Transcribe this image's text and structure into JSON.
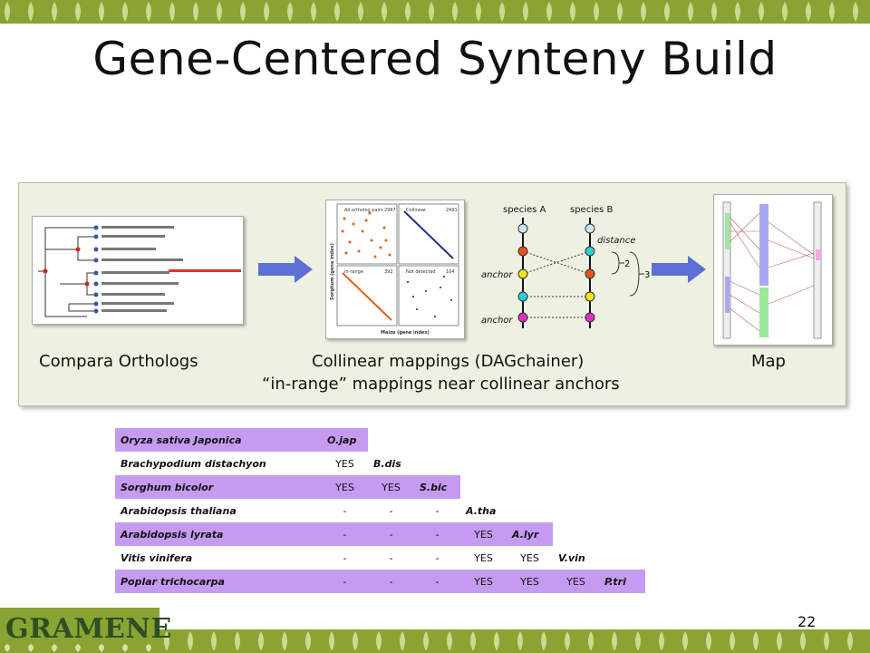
{
  "slide": {
    "title": "Gene-Centered Synteny Build",
    "page_number": "22"
  },
  "panel": {
    "caption_left": "Compara Orthologs",
    "caption_mid_1": "Collinear mappings (DAGchainer)",
    "caption_mid_2": "“in-range” mappings near collinear anchors",
    "caption_right": "Map",
    "dotplot": {
      "q1_label": "All ortholog pairs",
      "q1_count": "2987",
      "q2_label": "Collinear",
      "q2_count": "2491",
      "q3_label": "in-range",
      "q3_count": "392",
      "q4_label": "Not detected",
      "q4_count": "104",
      "ylabel": "Sorghum (gene index)",
      "xlabel": "Maize (gene index)"
    },
    "schema": {
      "species_a": "species A",
      "species_b": "species B",
      "distance": "distance",
      "anchor_1": "anchor",
      "anchor_2": "anchor",
      "num_2": "2",
      "num_3": "3"
    }
  },
  "ortholog_table": {
    "highlight_color": "#c59bf2",
    "rows": [
      {
        "species": "Oryza sativa Japonica",
        "cells": [],
        "abbr": "O.jap"
      },
      {
        "species": "Brachypodium distachyon",
        "cells": [
          "YES"
        ],
        "abbr": "B.dis"
      },
      {
        "species": "Sorghum bicolor",
        "cells": [
          "YES",
          "YES"
        ],
        "abbr": "S.bic"
      },
      {
        "species": "Arabidopsis thaliana",
        "cells": [
          "-",
          "-",
          "-"
        ],
        "abbr": "A.tha"
      },
      {
        "species": "Arabidopsis lyrata",
        "cells": [
          "-",
          "-",
          "-",
          "YES"
        ],
        "abbr": "A.lyr"
      },
      {
        "species": "Vitis vinifera",
        "cells": [
          "-",
          "-",
          "-",
          "YES",
          "YES"
        ],
        "abbr": "V.vin"
      },
      {
        "species": "Poplar trichocarpa",
        "cells": [
          "-",
          "-",
          "-",
          "YES",
          "YES",
          "YES"
        ],
        "abbr": "P.tri"
      }
    ]
  },
  "logo": {
    "text": "GRAMENE"
  },
  "colors": {
    "band_green": "#8aa434",
    "arrow_blue": "#5b6fd6",
    "row_purple": "#c59bf2"
  }
}
